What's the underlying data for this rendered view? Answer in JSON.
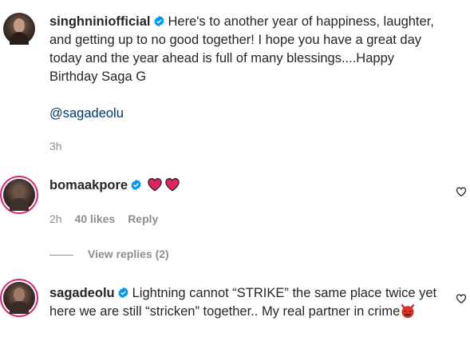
{
  "comments": [
    {
      "username": "singhniniofficial",
      "text": "Here's to another year of happiness, laughter, and getting up to no good together! I hope you have a great day today and the year ahead is full of many blessings....Happy Birthday Saga G",
      "mention": "@sagadeolu",
      "time": "3h"
    },
    {
      "username": "bomaakpore",
      "time": "2h",
      "likes": "40 likes",
      "reply_label": "Reply",
      "view_replies": "View replies (2)",
      "emojis": [
        "red-heart-emoji",
        "red-heart-emoji"
      ]
    },
    {
      "username": "sagadeolu",
      "text": "Lightning cannot “STRIKE” the same place twice yet here we are still “stricken” together.. My real partner in crime",
      "emojis": [
        "smiling-devil-emoji"
      ]
    }
  ],
  "colors": {
    "text": "#262626",
    "meta": "#8e8e8e",
    "verified": "#0095f6",
    "mention": "#00376b",
    "heart": "#e0245e"
  },
  "icons": [
    "verified-badge-icon",
    "heart-outline-icon"
  ]
}
